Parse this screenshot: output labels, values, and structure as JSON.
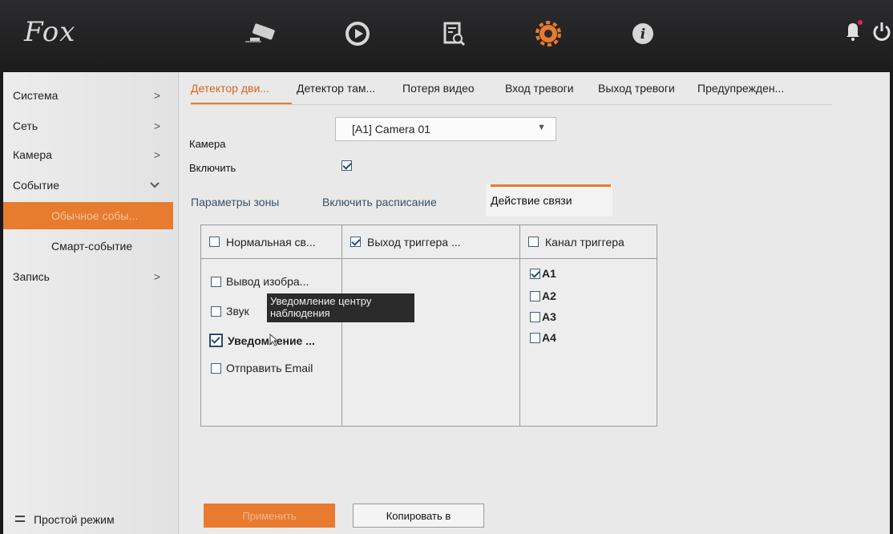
{
  "brand": {
    "logo_text": "Fox"
  },
  "topnav": {
    "icons": [
      "camera-icon",
      "playback-icon",
      "search-file-icon",
      "settings-icon",
      "info-icon"
    ],
    "right_icons": [
      "bell-icon",
      "power-icon"
    ],
    "accent_color": "#e77b2f"
  },
  "sidebar": {
    "items": [
      {
        "label": "Система",
        "arrow": ">"
      },
      {
        "label": "Сеть",
        "arrow": ">"
      },
      {
        "label": "Камера",
        "arrow": ">"
      },
      {
        "label": "Событие",
        "arrow": "v"
      },
      {
        "label": "Обычное собы..."
      },
      {
        "label": "Смарт-событие"
      },
      {
        "label": "Запись",
        "arrow": ">"
      }
    ],
    "footer_label": "Простой режим"
  },
  "tabs": [
    {
      "label": "Детектор дви..."
    },
    {
      "label": "Детектор там..."
    },
    {
      "label": "Потеря видео"
    },
    {
      "label": "Вход тревоги"
    },
    {
      "label": "Выход тревоги"
    },
    {
      "label": "Предупрежден..."
    }
  ],
  "form": {
    "camera_label": "Камера",
    "camera_value": "[A1] Camera 01",
    "enable_label": "Включить"
  },
  "subtabs": [
    {
      "label": "Параметры зоны"
    },
    {
      "label": "Включить расписание"
    },
    {
      "label": "Действие связи"
    }
  ],
  "grid": {
    "col1_header": "Нормальная св...",
    "col2_header": "Выход триггера ...",
    "col3_header": "Канал триггера",
    "col1_items": [
      {
        "label": "Вывод изобра...",
        "checked": false
      },
      {
        "label": "Звук",
        "checked": false
      },
      {
        "label": "Уведомление ...",
        "checked": true
      },
      {
        "label": "Отправить Email",
        "checked": false
      }
    ],
    "channels": [
      {
        "label": "A1",
        "checked": true
      },
      {
        "label": "A2",
        "checked": false
      },
      {
        "label": "A3",
        "checked": false
      },
      {
        "label": "A4",
        "checked": false
      }
    ]
  },
  "tooltip": {
    "line1": "Уведомление центру",
    "line2": "наблюдения"
  },
  "buttons": {
    "apply": "Применить",
    "copy": "Копировать в"
  }
}
